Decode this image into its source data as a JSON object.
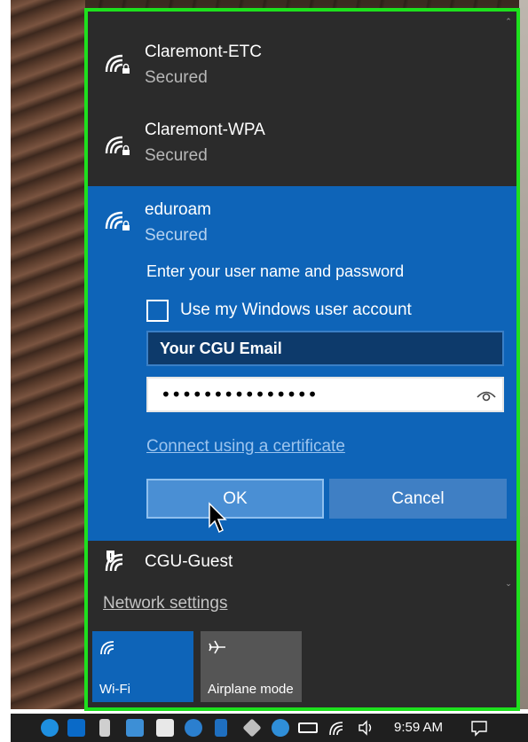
{
  "networks": [
    {
      "name": "Claremont-ETC",
      "status": "Secured",
      "icon": "wifi-secured-icon"
    },
    {
      "name": "Claremont-WPA",
      "status": "Secured",
      "icon": "wifi-secured-icon"
    }
  ],
  "selected_network": {
    "name": "eduroam",
    "status": "Secured",
    "icon": "wifi-secured-icon",
    "prompt": "Enter your user name and password",
    "use_windows_account_label": "Use my Windows user account",
    "use_windows_account_checked": false,
    "username_value": "Your CGU Email",
    "password_value": "•••••••••••••••",
    "certificate_link": "Connect using a certificate",
    "ok_label": "OK",
    "cancel_label": "Cancel"
  },
  "guest_network": {
    "name": "CGU-Guest",
    "icon": "wifi-shield-icon"
  },
  "network_settings_label": "Network settings",
  "quick_actions": [
    {
      "label": "Wi-Fi",
      "icon": "wifi-icon",
      "active": true
    },
    {
      "label": "Airplane mode",
      "icon": "airplane-icon",
      "active": false
    }
  ],
  "taskbar": {
    "time": "9:59 AM",
    "icons": [
      "skype-icon",
      "outlook-icon",
      "usb-icon",
      "app-icon",
      "defender-icon",
      "sync-icon",
      "bluetooth-icon",
      "diamond-icon",
      "browser-icon",
      "arrow-icon",
      "battery-icon",
      "wifi-icon",
      "volume-icon",
      "notification-icon"
    ]
  },
  "colors": {
    "highlight_border": "#1de01d",
    "selected_bg": "#0e64b8",
    "flyout_bg": "#2b2b2b",
    "link": "#9cc4ee"
  }
}
